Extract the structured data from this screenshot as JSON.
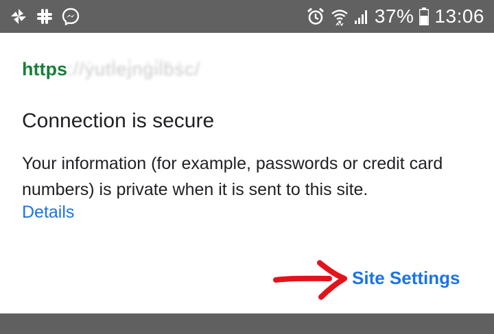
{
  "status_bar": {
    "icons_left": [
      "pinwheel-icon",
      "slack-icon",
      "messenger-icon"
    ],
    "icons_right": [
      "alarm-icon",
      "wifi-icon",
      "signal-icon",
      "battery-icon"
    ],
    "battery": "37%",
    "time": "13:06"
  },
  "dialog": {
    "url_scheme": "https",
    "url_rest": "://ẏutl̇ej̇nġi̇l̇ḃṡc/",
    "title": "Connection is secure",
    "description": "Your information (for example, passwords or credit card numbers) is private when it is sent to this site.",
    "details_link": "Details",
    "site_settings_button": "Site Settings"
  },
  "colors": {
    "status_bar_bg": "#616161",
    "https_green": "#188038",
    "link_blue": "#1a73e8",
    "annotation_arrow": "#e3131b"
  }
}
